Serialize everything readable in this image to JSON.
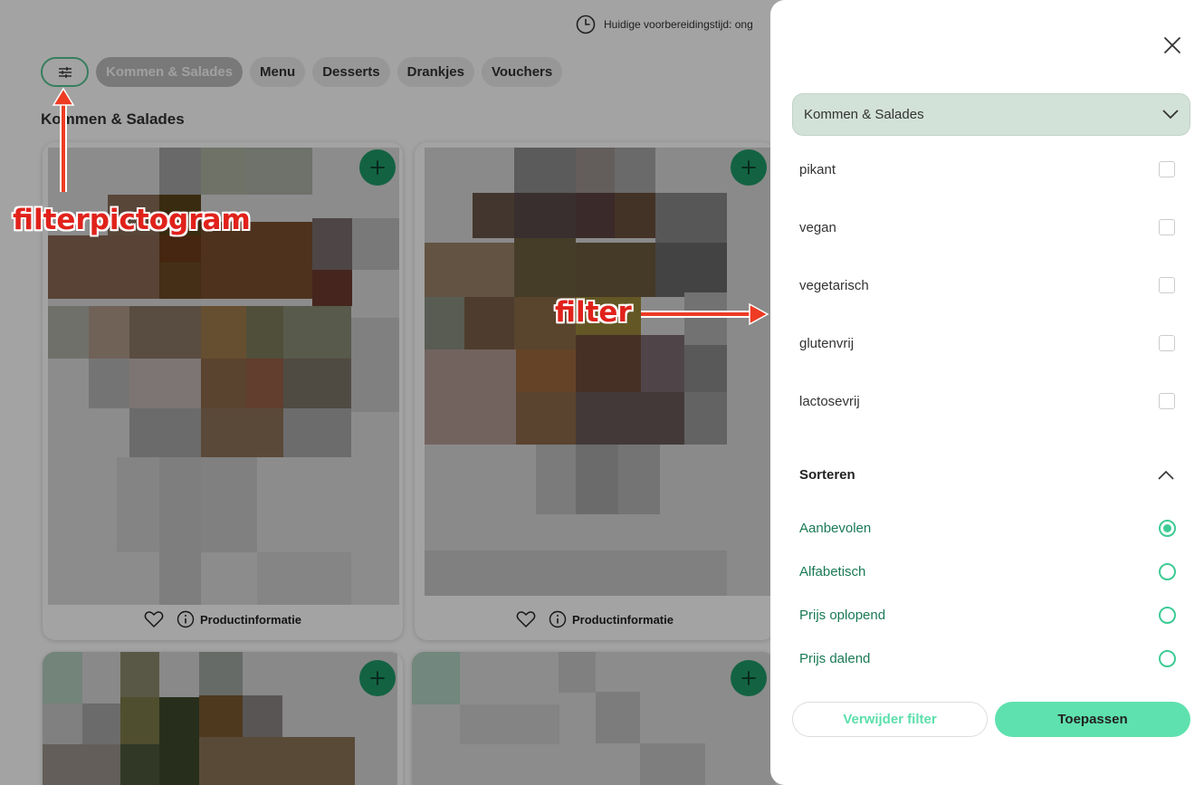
{
  "header": {
    "prep_time_text": "Huidige voorbereidingstijd: ong",
    "clock_icon": "clock-icon"
  },
  "nav": {
    "filter_icon": "sliders-icon",
    "categories": [
      {
        "label": "Kommen & Salades",
        "active": true
      },
      {
        "label": "Menu",
        "active": false
      },
      {
        "label": "Desserts",
        "active": false
      },
      {
        "label": "Drankjes",
        "active": false
      },
      {
        "label": "Vouchers",
        "active": false
      }
    ]
  },
  "section": {
    "title": "Kommen & Salades"
  },
  "products": [
    {
      "info_label": "Productinformatie"
    },
    {
      "info_label": "Productinformatie"
    }
  ],
  "annotations": {
    "filter_icon_note": "filterpictogram",
    "filter_note": "filter",
    "color": "#e0221b"
  },
  "drawer": {
    "category_select": {
      "value": "Kommen & Salades"
    },
    "filters": [
      {
        "label": "pikant",
        "checked": false
      },
      {
        "label": "vegan",
        "checked": false
      },
      {
        "label": "vegetarisch",
        "checked": false
      },
      {
        "label": "glutenvrij",
        "checked": false
      },
      {
        "label": "lactosevrij",
        "checked": false
      }
    ],
    "sort": {
      "title": "Sorteren",
      "options": [
        {
          "label": "Aanbevolen",
          "selected": true
        },
        {
          "label": "Alfabetisch",
          "selected": false
        },
        {
          "label": "Prijs oplopend",
          "selected": false
        },
        {
          "label": "Prijs dalend",
          "selected": false
        }
      ]
    },
    "buttons": {
      "clear": "Verwijder filter",
      "apply": "Toepassen"
    }
  },
  "colors": {
    "accent": "#5ee1ae",
    "accent_dark": "#1f9c6a",
    "select_bg": "#d3e2d9"
  }
}
